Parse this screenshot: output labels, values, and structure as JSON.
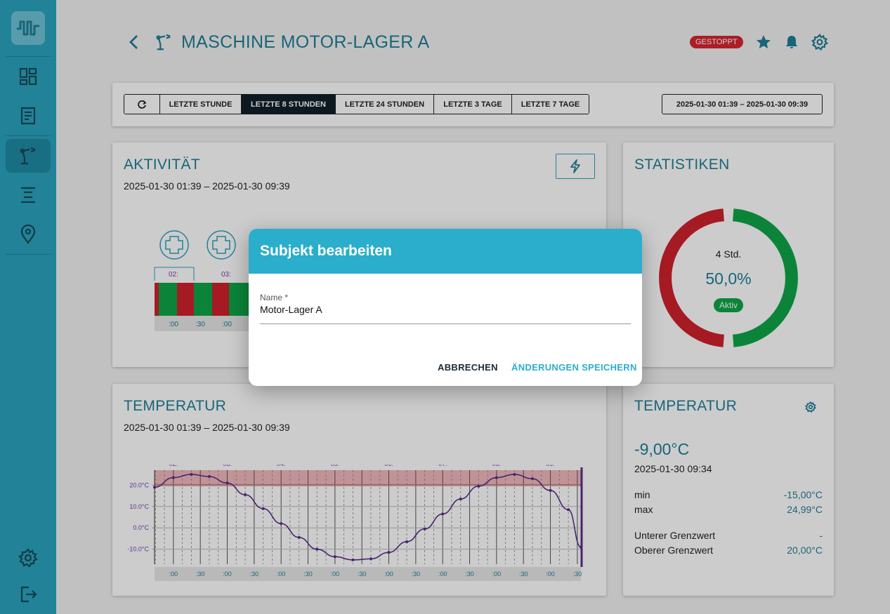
{
  "header": {
    "title": "MASCHINE MOTOR-LAGER A",
    "status_badge": "GESTOPPT"
  },
  "range": {
    "buttons": [
      "LETZTE STUNDE",
      "LETZTE 8 STUNDEN",
      "LETZTE 24 STUNDEN",
      "LETZTE 3 TAGE",
      "LETZTE 7 TAGE"
    ],
    "active": "LETZTE 8 STUNDEN",
    "date_range": "2025-01-30 01:39  –  2025-01-30 09:39"
  },
  "activity": {
    "title": "AKTIVITÄT",
    "range": "2025-01-30 01:39  –  2025-01-30 09:39",
    "hour_labels": [
      "02:",
      "03:"
    ],
    "tick_labels": [
      ":00",
      ":30",
      ":00"
    ]
  },
  "stats": {
    "title": "STATISTIKEN",
    "duration": "4 Std.",
    "percent": "50,0%",
    "state": "Aktiv",
    "active_fraction": 0.5,
    "colors": {
      "active": "#0ea548",
      "inactive": "#d0212e"
    }
  },
  "temperature": {
    "title": "TEMPERATUR",
    "range": "2025-01-30 01:39  –  2025-01-30 09:39"
  },
  "temperature_panel": {
    "title": "TEMPERATUR",
    "current": "-9,00°C",
    "timestamp": "2025-01-30 09:34",
    "min_label": "min",
    "min_value": "-15,00°C",
    "max_label": "max",
    "max_value": "24,99°C",
    "lower_label": "Unterer Grenzwert",
    "lower_value": "-",
    "upper_label": "Oberer Grenzwert",
    "upper_value": "20,00°C"
  },
  "chart_data": {
    "type": "line",
    "title": "",
    "xlabel": "",
    "ylabel": "",
    "x_hour_labels": [
      "02:",
      "03:",
      "04:",
      "05:",
      "06:",
      "07:",
      "08:",
      "09:"
    ],
    "x_tick_labels": [
      ":00",
      ":30",
      ":00",
      ":30",
      ":00",
      ":30",
      ":00",
      ":30",
      ":00",
      ":30",
      ":00",
      ":30",
      ":00",
      ":30",
      ":00",
      ":30"
    ],
    "y_tick_labels": [
      "20.0°C",
      "10.0°C",
      "0.0°C",
      "-10.0°C"
    ],
    "ylim": [
      -17,
      27
    ],
    "upper_threshold": 20,
    "series": [
      {
        "x": [
          "01:39",
          "02:00",
          "02:20",
          "02:40",
          "03:00",
          "03:20",
          "03:40",
          "04:00",
          "04:20",
          "04:40",
          "05:00",
          "05:20",
          "05:40",
          "06:00",
          "06:20",
          "06:40",
          "07:00",
          "07:20",
          "07:40",
          "08:00",
          "08:20",
          "08:40",
          "09:00",
          "09:20",
          "09:34"
        ],
        "y": [
          19.0,
          23.5,
          25.0,
          24.0,
          21.0,
          15.5,
          9.0,
          2.0,
          -4.5,
          -10.0,
          -13.5,
          -15.0,
          -14.5,
          -11.5,
          -6.5,
          -0.5,
          6.5,
          13.5,
          19.5,
          23.5,
          25.0,
          23.0,
          17.5,
          8.5,
          -9.0
        ]
      }
    ]
  },
  "dialog": {
    "title": "Subjekt bearbeiten",
    "field_label": "Name *",
    "field_value": "Motor-Lager A",
    "cancel": "ABBRECHEN",
    "save": "ÄNDERUNGEN SPEICHERN"
  }
}
